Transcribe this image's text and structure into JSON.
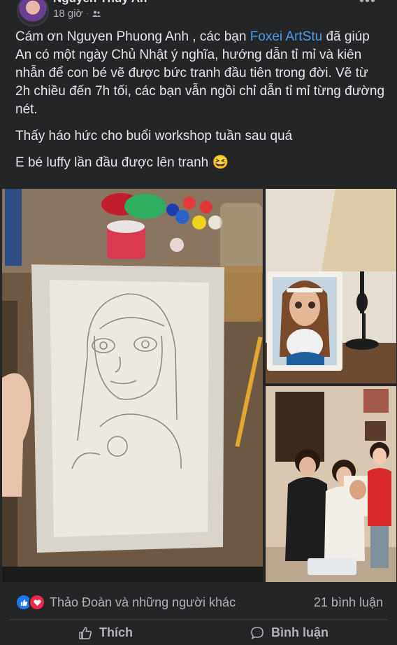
{
  "post": {
    "author": "Nguyen Thuy An",
    "time": "18 giờ",
    "privacy_icon": "friends-icon",
    "more_icon": "more-options-icon",
    "paragraphs": {
      "p1_before": "Cám ơn Nguyen Phuong Anh , các bạn ",
      "p1_mention": "Foxei ArtStu",
      "p1_after": " đã giúp An có một ngày Chủ Nhật ý nghĩa, hướng dẫn tỉ mỉ và kiên nhẫn để con bé vẽ được bức tranh đầu tiên trong đời. Vẽ từ 2h chiều đến 7h tối, các bạn vẫn ngồi chỉ dẫn tỉ mỉ từng đường nét.",
      "p2": "Thấy háo hức cho buổi workshop tuần sau quá",
      "p3": "E bé luffy lần đầu được lên tranh 😆"
    },
    "images": {
      "main": "Pencil sketch of a girl with a dog on canvas, hand holding it above a table with paints",
      "top_right": "Finished painting of a girl hugging a white dog next to a lamp",
      "bottom_right": "Two women and a child posing with the painting"
    }
  },
  "footer": {
    "reactions_text": "Thảo Đoàn và những người khác",
    "comments_count": "21 bình luận",
    "like_label": "Thích",
    "comment_label": "Bình luận"
  },
  "colors": {
    "background": "#242526",
    "text": "#e4e6eb",
    "secondary_text": "#b0b3b8",
    "mention": "#4a9cf5",
    "like": "#1877f2",
    "love": "#f0284a"
  }
}
